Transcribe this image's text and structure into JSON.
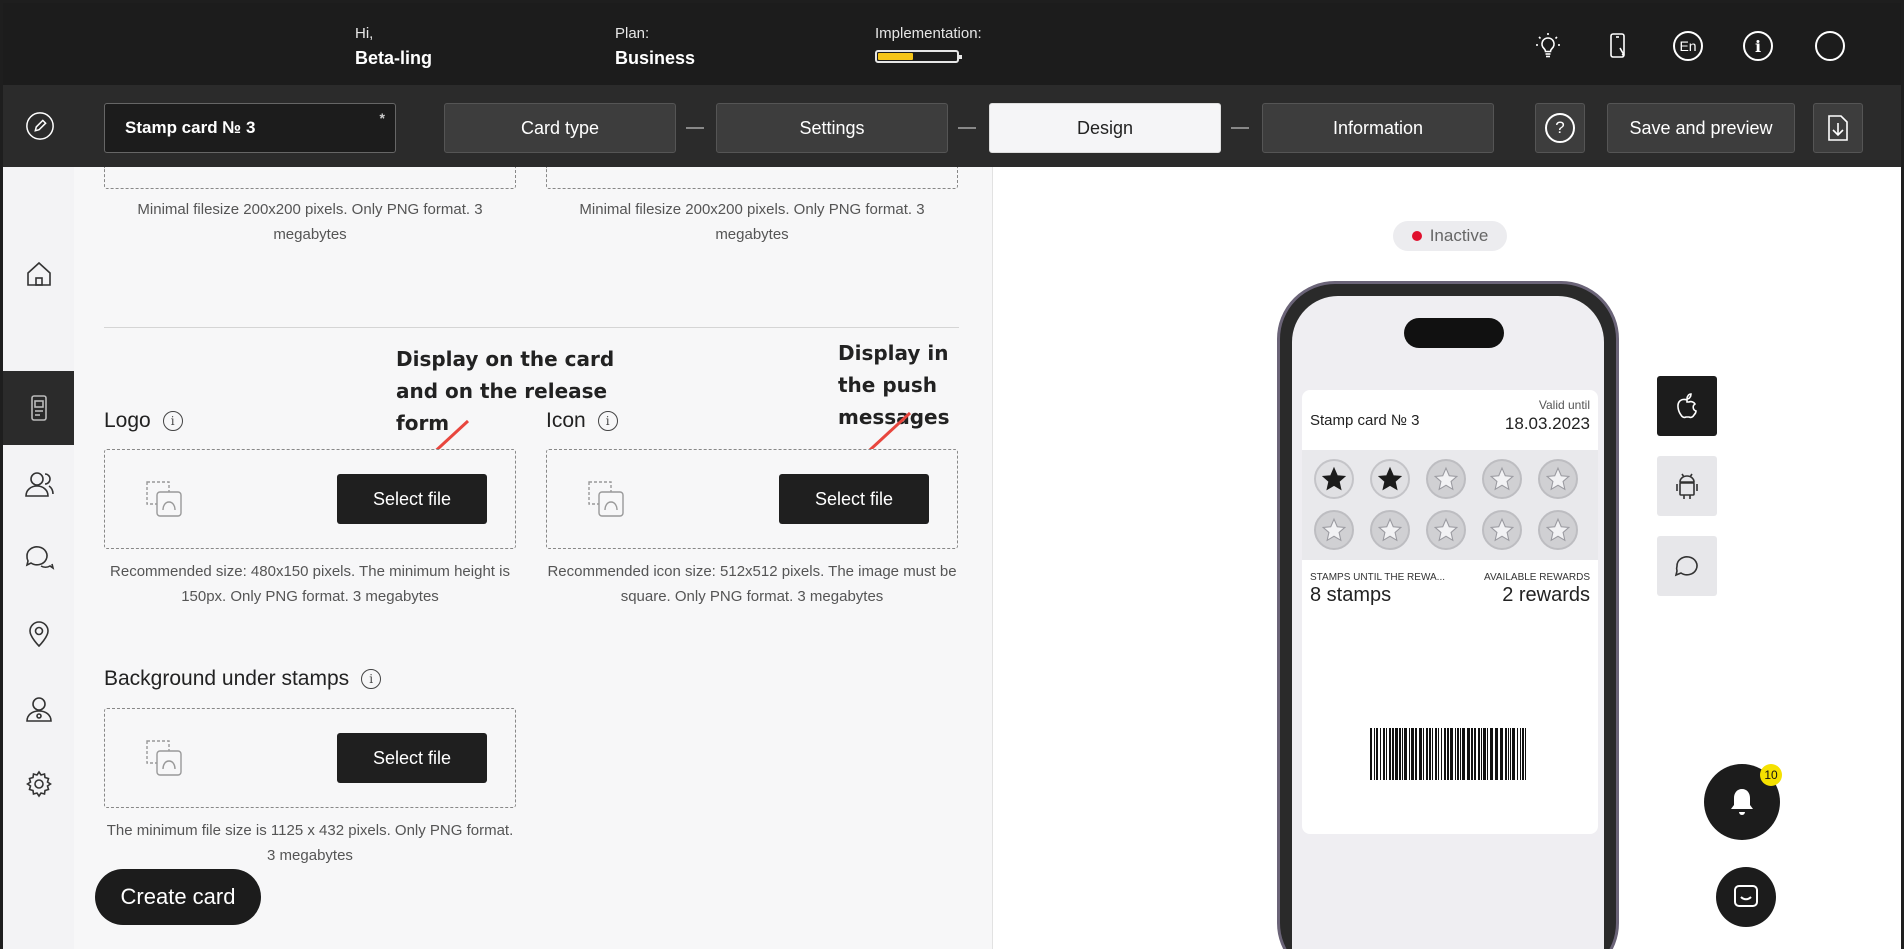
{
  "header": {
    "greeting_label": "Hi,",
    "user_name": "Beta-ling",
    "plan_label": "Plan:",
    "plan_value": "Business",
    "implementation_label": "Implementation:",
    "implementation_progress": 0.45,
    "icons": [
      "bulb-icon",
      "phone-icon",
      "language-icon",
      "info-icon",
      "profile-icon"
    ],
    "language": "En"
  },
  "stepbar": {
    "card_name": "Stamp card № 3",
    "required_mark": "*",
    "steps": [
      {
        "label": "Card type",
        "active": false
      },
      {
        "label": "Settings",
        "active": false
      },
      {
        "label": "Design",
        "active": true
      },
      {
        "label": "Information",
        "active": false
      }
    ],
    "save_label": "Save and preview"
  },
  "sidebar": {
    "items": [
      "home-icon",
      "card-icon",
      "clients-icon",
      "messages-icon",
      "location-icon",
      "user-icon",
      "settings-icon"
    ],
    "active_index": 1
  },
  "editor": {
    "top_hint_left": "Minimal filesize 200x200 pixels. Only PNG format. 3 megabytes",
    "top_hint_right": "Minimal filesize 200x200 pixels. Only PNG format. 3 megabytes",
    "annotation_logo": "Display on the card and on the release form",
    "annotation_icon": "Display in the push messages",
    "logo": {
      "label": "Logo",
      "button": "Select file",
      "hint": "Recommended size: 480x150 pixels. The minimum height is 150px. Only PNG format. 3 megabytes"
    },
    "icon": {
      "label": "Icon",
      "button": "Select file",
      "hint": "Recommended icon size: 512x512 pixels. The image must be square. Only PNG format. 3 megabytes"
    },
    "background": {
      "label": "Background under stamps",
      "button": "Select file",
      "hint": "The minimum file size is 1125 x 432 pixels. Only PNG format. 3 megabytes"
    },
    "create_button": "Create card"
  },
  "preview": {
    "status": "Inactive",
    "status_color": "#e0102e",
    "card_title": "Stamp card № 3",
    "valid_label": "Valid until",
    "valid_date": "18.03.2023",
    "stamps_total": 10,
    "stamps_filled": 2,
    "stamps_until_label": "STAMPS UNTIL THE REWA...",
    "stamps_until_value": "8 stamps",
    "rewards_label": "AVAILABLE REWARDS",
    "rewards_value": "2 rewards",
    "platforms": [
      "apple-icon",
      "android-icon",
      "chat-bubble-icon"
    ],
    "notification_count": "10"
  }
}
